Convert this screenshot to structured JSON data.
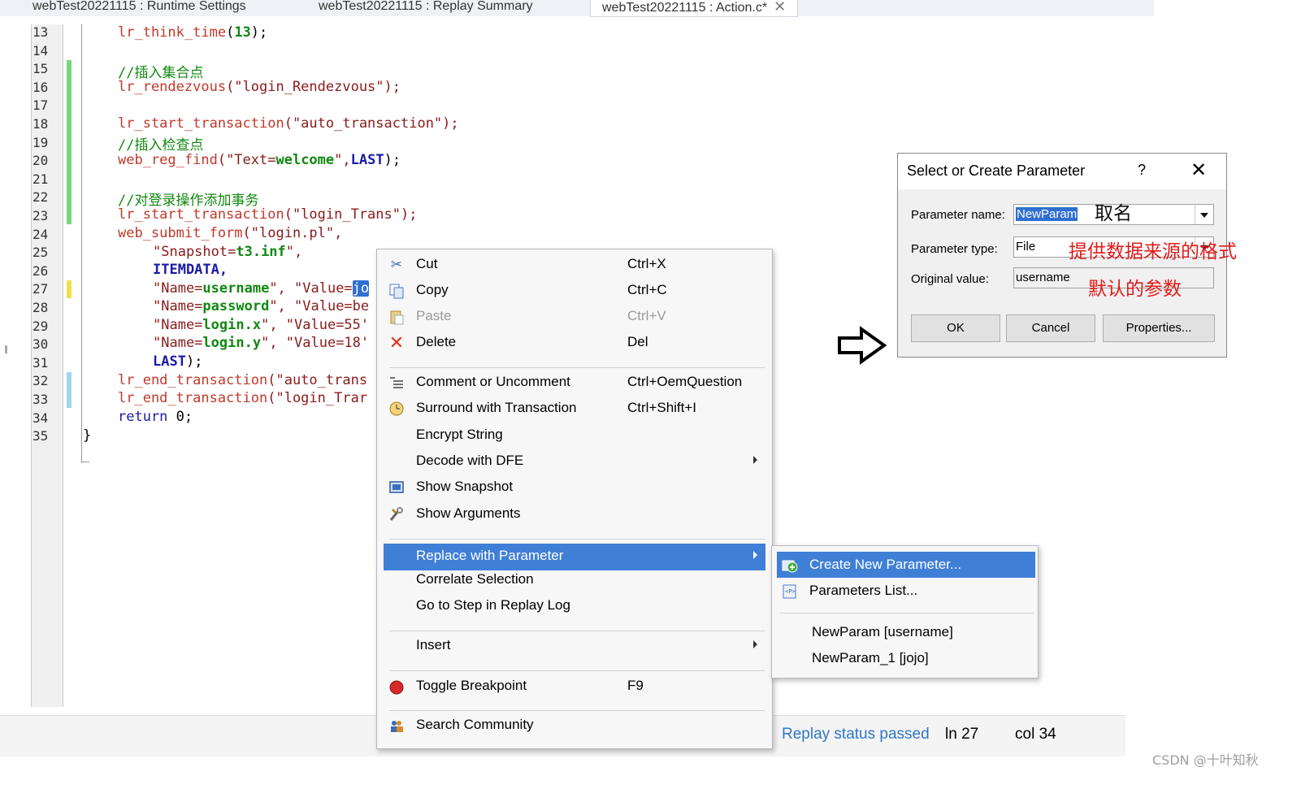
{
  "tabs": [
    {
      "label": "webTest20221115 : Runtime Settings"
    },
    {
      "label": "webTest20221115 : Replay Summary"
    },
    {
      "label": "webTest20221115 : Action.c*"
    }
  ],
  "tab_close_glyph": "✕",
  "editor": {
    "line_numbers": [
      "13",
      "14",
      "15",
      "16",
      "17",
      "18",
      "19",
      "20",
      "21",
      "22",
      "23",
      "24",
      "25",
      "26",
      "27",
      "28",
      "29",
      "30",
      "31",
      "32",
      "33",
      "34",
      "35"
    ],
    "code": {
      "l13_fn": "lr_think_time",
      "l13_rest_a": "(",
      "l13_num": "13",
      "l13_rest_b": ");",
      "l15": "//插入集合点",
      "l16_fn": "lr_rendezvous",
      "l16_str": "(\"login_Rendezvous\");",
      "l18_fn": "lr_start_transaction",
      "l18_str": "(\"auto_transaction\");",
      "l19": "//插入检查点",
      "l20_fn": "web_reg_find",
      "l20_a": "(\"Text=",
      "l20_b": "welcome",
      "l20_c": "\",",
      "l20_d": "LAST",
      "l20_e": ");",
      "l22": "//对登录操作添加事务",
      "l23_fn": "lr_start_transaction",
      "l23_str": "(\"login_Trans\");",
      "l24_fn": "web_submit_form",
      "l24_str": "(\"login.pl\",",
      "l25_a": "\"Snapshot=",
      "l25_b": "t3.inf",
      "l25_c": "\",",
      "l26": "ITEMDATA,",
      "l27_a": "\"Name=",
      "l27_b": "username",
      "l27_c": "\", \"Value=",
      "l27_sel": "jo",
      "l28_a": "\"Name=",
      "l28_b": "password",
      "l28_c": "\", \"Value=be",
      "l29_a": "\"Name=",
      "l29_b": "login.x",
      "l29_c": "\", \"Value=55'",
      "l30_a": "\"Name=",
      "l30_b": "login.y",
      "l30_c": "\", \"Value=18'",
      "l31_a": "LAST",
      "l31_b": ");",
      "l32_fn": "lr_end_transaction",
      "l32_str": "(\"auto_trans",
      "l33_fn": "lr_end_transaction",
      "l33_str": "(\"login_Trar",
      "l34_a": "return",
      "l34_b": " 0;",
      "l35": "}"
    }
  },
  "status": {
    "replay": "Replay status passed",
    "ln": "ln 27",
    "col": "col 34"
  },
  "context_menu": {
    "cut": {
      "label": "Cut",
      "shortcut": "Ctrl+X"
    },
    "copy": {
      "label": "Copy",
      "shortcut": "Ctrl+C"
    },
    "paste": {
      "label": "Paste",
      "shortcut": "Ctrl+V"
    },
    "delete": {
      "label": "Delete",
      "shortcut": "Del"
    },
    "comment": {
      "label": "Comment or Uncomment",
      "shortcut": "Ctrl+OemQuestion"
    },
    "surround": {
      "label": "Surround with Transaction",
      "shortcut": "Ctrl+Shift+I"
    },
    "encrypt": {
      "label": "Encrypt String"
    },
    "decode": {
      "label": "Decode with DFE"
    },
    "snapshot": {
      "label": "Show Snapshot"
    },
    "arguments": {
      "label": "Show Arguments"
    },
    "replace": {
      "label": "Replace with Parameter"
    },
    "correlate": {
      "label": "Correlate Selection"
    },
    "goto_step": {
      "label": "Go to Step in Replay Log"
    },
    "insert": {
      "label": "Insert"
    },
    "breakpoint": {
      "label": "Toggle Breakpoint",
      "shortcut": "F9"
    },
    "community": {
      "label": "Search Community"
    }
  },
  "submenu": {
    "create": "Create New Parameter...",
    "list": "Parameters List...",
    "p1": "NewParam [username]",
    "p2": "NewParam_1 [jojo]"
  },
  "dialog": {
    "title": "Select or Create Parameter",
    "help": "?",
    "close": "✕",
    "name_label": "Parameter name:",
    "name_value": "NewParam",
    "type_label": "Parameter type:",
    "type_value": "File",
    "orig_label": "Original value:",
    "orig_value": "username",
    "ok": "OK",
    "cancel": "Cancel",
    "properties": "Properties..."
  },
  "annotations": {
    "name": "取名",
    "type": "提供数据来源的格式",
    "orig": "默认的参数"
  },
  "watermark": "CSDN @十叶知秋",
  "colors": {
    "menu_highlight": "#3f7fd6",
    "annotation": "#e31a1a",
    "status_passed": "#2e78c8"
  }
}
